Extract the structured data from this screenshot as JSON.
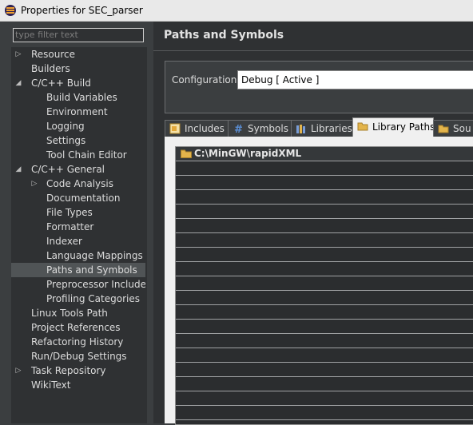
{
  "window": {
    "title": "Properties for SEC_parser"
  },
  "sidebar": {
    "filter_placeholder": "type filter text",
    "items": [
      {
        "label": "Resource",
        "arrow": "▷"
      },
      {
        "label": "Builders",
        "arrow": ""
      },
      {
        "label": "C/C++ Build",
        "arrow": "◢"
      },
      {
        "label": "Build Variables",
        "arrow": ""
      },
      {
        "label": "Environment",
        "arrow": ""
      },
      {
        "label": "Logging",
        "arrow": ""
      },
      {
        "label": "Settings",
        "arrow": ""
      },
      {
        "label": "Tool Chain Editor",
        "arrow": ""
      },
      {
        "label": "C/C++ General",
        "arrow": "◢"
      },
      {
        "label": "Code Analysis",
        "arrow": "▷"
      },
      {
        "label": "Documentation",
        "arrow": ""
      },
      {
        "label": "File Types",
        "arrow": ""
      },
      {
        "label": "Formatter",
        "arrow": ""
      },
      {
        "label": "Indexer",
        "arrow": ""
      },
      {
        "label": "Language Mappings",
        "arrow": ""
      },
      {
        "label": "Paths and Symbols",
        "arrow": ""
      },
      {
        "label": "Preprocessor Include Pa",
        "arrow": ""
      },
      {
        "label": "Profiling Categories",
        "arrow": ""
      },
      {
        "label": "Linux Tools Path",
        "arrow": ""
      },
      {
        "label": "Project References",
        "arrow": ""
      },
      {
        "label": "Refactoring History",
        "arrow": ""
      },
      {
        "label": "Run/Debug Settings",
        "arrow": ""
      },
      {
        "label": "Task Repository",
        "arrow": "▷"
      },
      {
        "label": "WikiText",
        "arrow": ""
      }
    ],
    "selected": "Paths and Symbols"
  },
  "main": {
    "title": "Paths and Symbols",
    "configuration_label": "Configuration:",
    "configuration_value": "Debug  [ Active ]",
    "tabs": [
      {
        "label": "Includes",
        "icon": "includes-icon"
      },
      {
        "label": "Symbols",
        "icon": "hash-icon"
      },
      {
        "label": "Libraries",
        "icon": "libraries-icon"
      },
      {
        "label": "Library Paths",
        "icon": "folder-icon"
      },
      {
        "label": "Sou",
        "icon": "folder-icon"
      }
    ],
    "active_tab": "Library Paths",
    "library_paths": [
      "C:\\MinGW\\rapidXML"
    ]
  },
  "colors": {
    "accent_folder": "#e3b44b",
    "selection": "#505456"
  }
}
